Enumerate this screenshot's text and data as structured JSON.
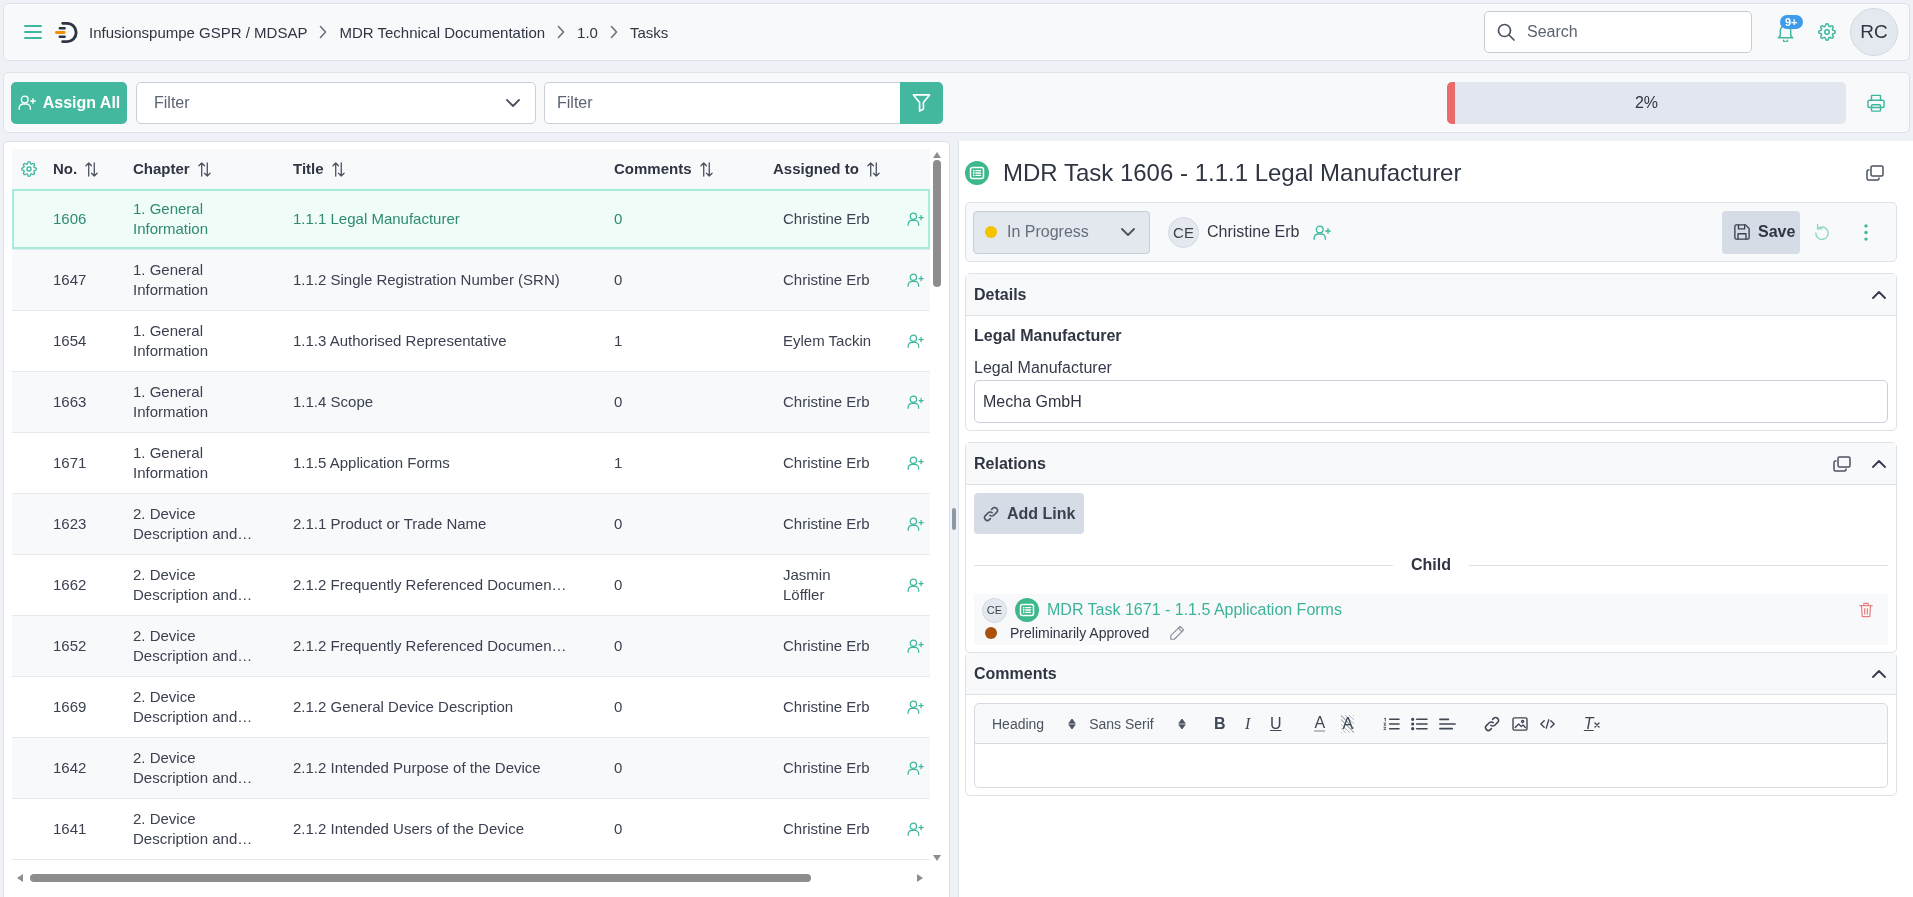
{
  "header": {
    "breadcrumb": [
      "Infusionspumpe GSPR / MDSAP",
      "MDR Technical Documentation",
      "1.0",
      "Tasks"
    ],
    "search": {
      "placeholder": "Search"
    },
    "notification_badge": "9+",
    "user_initials": "RC"
  },
  "toolbar": {
    "assign_all_button": "Assign All",
    "chapter_filter": {
      "placeholder": "Filter"
    },
    "text_filter": {
      "placeholder": "Filter"
    },
    "progress": {
      "level": 0.02,
      "reading": "2%"
    }
  },
  "table": {
    "columns": [
      "No.",
      "Chapter",
      "Title",
      "Comments",
      "Assigned to"
    ],
    "rows": [
      {
        "no": "1606",
        "chapter": "1. General Information",
        "title": "1.1.1 Legal Manufacturer",
        "comments": "0",
        "assigned_to": "Christine Erb",
        "selected": true
      },
      {
        "no": "1647",
        "chapter": "1. General Information",
        "title": "1.1.2 Single Registration Number (SRN)",
        "comments": "0",
        "assigned_to": "Christine Erb",
        "selected": false
      },
      {
        "no": "1654",
        "chapter": "1. General Information",
        "title": "1.1.3 Authorised Representative",
        "comments": "1",
        "assigned_to": "Eylem Tackin",
        "selected": false
      },
      {
        "no": "1663",
        "chapter": "1. General Information",
        "title": "1.1.4 Scope",
        "comments": "0",
        "assigned_to": "Christine Erb",
        "selected": false
      },
      {
        "no": "1671",
        "chapter": "1. General Information",
        "title": "1.1.5 Application Forms",
        "comments": "1",
        "assigned_to": "Christine Erb",
        "selected": false
      },
      {
        "no": "1623",
        "chapter": "2. Device Description and…",
        "title": "2.1.1 Product or Trade Name",
        "comments": "0",
        "assigned_to": "Christine Erb",
        "selected": false
      },
      {
        "no": "1662",
        "chapter": "2. Device Description and…",
        "title": "2.1.2 Frequently Referenced Documen…",
        "comments": "0",
        "assigned_to": "Jasmin Löffler",
        "selected": false
      },
      {
        "no": "1652",
        "chapter": "2. Device Description and…",
        "title": "2.1.2 Frequently Referenced Documen…",
        "comments": "0",
        "assigned_to": "Christine Erb",
        "selected": false
      },
      {
        "no": "1669",
        "chapter": "2. Device Description and…",
        "title": "2.1.2 General Device Description",
        "comments": "0",
        "assigned_to": "Christine Erb",
        "selected": false
      },
      {
        "no": "1642",
        "chapter": "2. Device Description and…",
        "title": "2.1.2 Intended Purpose of the Device",
        "comments": "0",
        "assigned_to": "Christine Erb",
        "selected": false
      },
      {
        "no": "1641",
        "chapter": "2. Device Description and…",
        "title": "2.1.2 Intended Users of the Device",
        "comments": "0",
        "assigned_to": "Christine Erb",
        "selected": false
      }
    ]
  },
  "detail": {
    "title": "MDR Task 1606 - 1.1.1 Legal Manufacturer",
    "status": {
      "label": "In Progress",
      "color": "#f3c300"
    },
    "assignee": {
      "initials": "CE",
      "name": "Christine Erb"
    },
    "save_button": "Save",
    "sections": [
      {
        "kind": "details",
        "heading": "Details",
        "expanded": true,
        "group_title": "Legal Manufacturer",
        "fields": [
          {
            "label": "Legal Manufacturer",
            "value": "Mecha GmbH"
          }
        ]
      },
      {
        "kind": "relations",
        "heading": "Relations",
        "expanded": true,
        "add_link_button": "Add Link",
        "divider_label": "Child",
        "links": [
          {
            "initials": "CE",
            "title": "MDR Task 1671 - 1.1.5 Application Forms",
            "status": {
              "label": "Preliminarily Approved",
              "color": "#a9500d"
            }
          }
        ]
      },
      {
        "kind": "comments",
        "heading": "Comments",
        "expanded": true,
        "editor_toolbar": [
          {
            "kind": "select",
            "label": "Heading"
          },
          {
            "kind": "select",
            "label": "Sans Serif"
          },
          {
            "kind": "bold",
            "label": "B"
          },
          {
            "kind": "italic",
            "label": "I"
          },
          {
            "kind": "underline",
            "label": "U"
          },
          {
            "kind": "text-color",
            "label": "A"
          },
          {
            "kind": "highlight",
            "label": "A"
          },
          {
            "kind": "ordered-list"
          },
          {
            "kind": "bullet-list"
          },
          {
            "kind": "align"
          },
          {
            "kind": "link"
          },
          {
            "kind": "image"
          },
          {
            "kind": "code"
          },
          {
            "kind": "clear-format",
            "label": "T"
          }
        ]
      }
    ]
  }
}
